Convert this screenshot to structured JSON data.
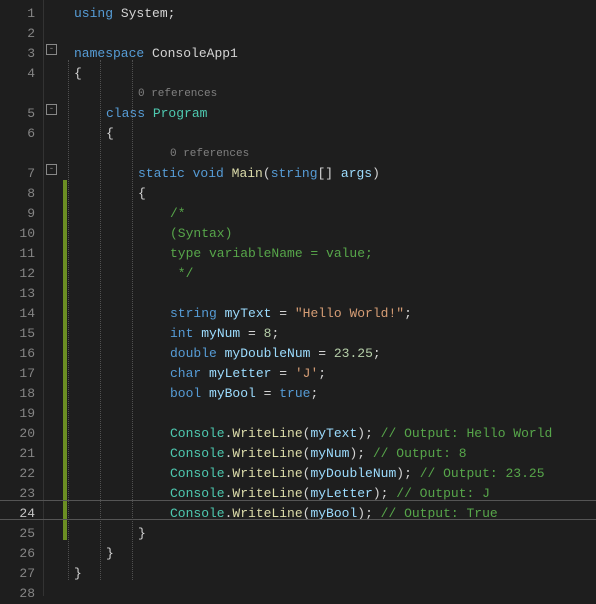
{
  "lineCount": 28,
  "currentLine": 24,
  "changeBar": {
    "startLine": 8,
    "endLine": 25
  },
  "foldMarks": [
    {
      "line": 3,
      "glyph": "-"
    },
    {
      "line": 5,
      "glyph": "-"
    },
    {
      "line": 7,
      "glyph": "-"
    }
  ],
  "codeLens": [
    {
      "line": 5,
      "indent": 2,
      "text": "0 references"
    },
    {
      "line": 7,
      "indent": 3,
      "text": "0 references"
    }
  ],
  "code": {
    "l1": {
      "indent": 0,
      "tokens": [
        [
          "kw",
          "using"
        ],
        [
          "p",
          " "
        ],
        [
          "ns",
          "System"
        ],
        [
          "p",
          ";"
        ]
      ]
    },
    "l2": {
      "indent": 0,
      "tokens": []
    },
    "l3": {
      "indent": 0,
      "tokens": [
        [
          "kw",
          "namespace"
        ],
        [
          "p",
          " "
        ],
        [
          "ns",
          "ConsoleApp1"
        ]
      ]
    },
    "l4": {
      "indent": 0,
      "tokens": [
        [
          "p",
          "{"
        ]
      ]
    },
    "l5": {
      "indent": 1,
      "tokens": [
        [
          "kw",
          "class"
        ],
        [
          "p",
          " "
        ],
        [
          "cls",
          "Program"
        ]
      ]
    },
    "l6": {
      "indent": 1,
      "tokens": [
        [
          "p",
          "{"
        ]
      ]
    },
    "l7": {
      "indent": 2,
      "tokens": [
        [
          "kw",
          "static"
        ],
        [
          "p",
          " "
        ],
        [
          "kw",
          "void"
        ],
        [
          "p",
          " "
        ],
        [
          "mth",
          "Main"
        ],
        [
          "p",
          "("
        ],
        [
          "kw",
          "string"
        ],
        [
          "p",
          "[] "
        ],
        [
          "var",
          "args"
        ],
        [
          "p",
          ")"
        ]
      ]
    },
    "l8": {
      "indent": 2,
      "tokens": [
        [
          "p",
          "{"
        ]
      ]
    },
    "l9": {
      "indent": 3,
      "tokens": [
        [
          "cmt",
          "/*"
        ]
      ]
    },
    "l10": {
      "indent": 3,
      "tokens": [
        [
          "cmt",
          "(Syntax)"
        ]
      ]
    },
    "l11": {
      "indent": 3,
      "tokens": [
        [
          "cmt",
          "type variableName = value;"
        ]
      ]
    },
    "l12": {
      "indent": 3,
      "tokens": [
        [
          "cmt",
          " */"
        ]
      ]
    },
    "l13": {
      "indent": 0,
      "tokens": []
    },
    "l14": {
      "indent": 3,
      "tokens": [
        [
          "kw",
          "string"
        ],
        [
          "p",
          " "
        ],
        [
          "var",
          "myText"
        ],
        [
          "p",
          " = "
        ],
        [
          "str",
          "\"Hello World!\""
        ],
        [
          "p",
          ";"
        ]
      ]
    },
    "l15": {
      "indent": 3,
      "tokens": [
        [
          "kw",
          "int"
        ],
        [
          "p",
          " "
        ],
        [
          "var",
          "myNum"
        ],
        [
          "p",
          " = "
        ],
        [
          "num",
          "8"
        ],
        [
          "p",
          ";"
        ]
      ]
    },
    "l16": {
      "indent": 3,
      "tokens": [
        [
          "kw",
          "double"
        ],
        [
          "p",
          " "
        ],
        [
          "var",
          "myDoubleNum"
        ],
        [
          "p",
          " = "
        ],
        [
          "num",
          "23.25"
        ],
        [
          "p",
          ";"
        ]
      ]
    },
    "l17": {
      "indent": 3,
      "tokens": [
        [
          "kw",
          "char"
        ],
        [
          "p",
          " "
        ],
        [
          "var",
          "myLetter"
        ],
        [
          "p",
          " = "
        ],
        [
          "str",
          "'J'"
        ],
        [
          "p",
          ";"
        ]
      ]
    },
    "l18": {
      "indent": 3,
      "tokens": [
        [
          "kw",
          "bool"
        ],
        [
          "p",
          " "
        ],
        [
          "var",
          "myBool"
        ],
        [
          "p",
          " = "
        ],
        [
          "kw",
          "true"
        ],
        [
          "p",
          ";"
        ]
      ]
    },
    "l19": {
      "indent": 0,
      "tokens": []
    },
    "l20": {
      "indent": 3,
      "tokens": [
        [
          "cls",
          "Console"
        ],
        [
          "p",
          "."
        ],
        [
          "mth",
          "WriteLine"
        ],
        [
          "p",
          "("
        ],
        [
          "var",
          "myText"
        ],
        [
          "p",
          "); "
        ],
        [
          "cmt",
          "// Output: Hello World"
        ]
      ]
    },
    "l21": {
      "indent": 3,
      "tokens": [
        [
          "cls",
          "Console"
        ],
        [
          "p",
          "."
        ],
        [
          "mth",
          "WriteLine"
        ],
        [
          "p",
          "("
        ],
        [
          "var",
          "myNum"
        ],
        [
          "p",
          "); "
        ],
        [
          "cmt",
          "// Output: 8"
        ]
      ]
    },
    "l22": {
      "indent": 3,
      "tokens": [
        [
          "cls",
          "Console"
        ],
        [
          "p",
          "."
        ],
        [
          "mth",
          "WriteLine"
        ],
        [
          "p",
          "("
        ],
        [
          "var",
          "myDoubleNum"
        ],
        [
          "p",
          "); "
        ],
        [
          "cmt",
          "// Output: 23.25"
        ]
      ]
    },
    "l23": {
      "indent": 3,
      "tokens": [
        [
          "cls",
          "Console"
        ],
        [
          "p",
          "."
        ],
        [
          "mth",
          "WriteLine"
        ],
        [
          "p",
          "("
        ],
        [
          "var",
          "myLetter"
        ],
        [
          "p",
          "); "
        ],
        [
          "cmt",
          "// Output: J"
        ]
      ]
    },
    "l24": {
      "indent": 3,
      "tokens": [
        [
          "cls",
          "Console"
        ],
        [
          "p",
          "."
        ],
        [
          "mth",
          "WriteLine"
        ],
        [
          "p",
          "("
        ],
        [
          "var",
          "myBool"
        ],
        [
          "p",
          "); "
        ],
        [
          "cmt",
          "// Output: True"
        ]
      ]
    },
    "l25": {
      "indent": 2,
      "tokens": [
        [
          "p",
          "}"
        ]
      ]
    },
    "l26": {
      "indent": 1,
      "tokens": [
        [
          "p",
          "}"
        ]
      ]
    },
    "l27": {
      "indent": 0,
      "tokens": [
        [
          "p",
          "}"
        ]
      ]
    },
    "l28": {
      "indent": 0,
      "tokens": []
    }
  },
  "guides": {
    "indentWidth": 32,
    "levels": 3,
    "startLine": 4,
    "endLine": 27
  }
}
